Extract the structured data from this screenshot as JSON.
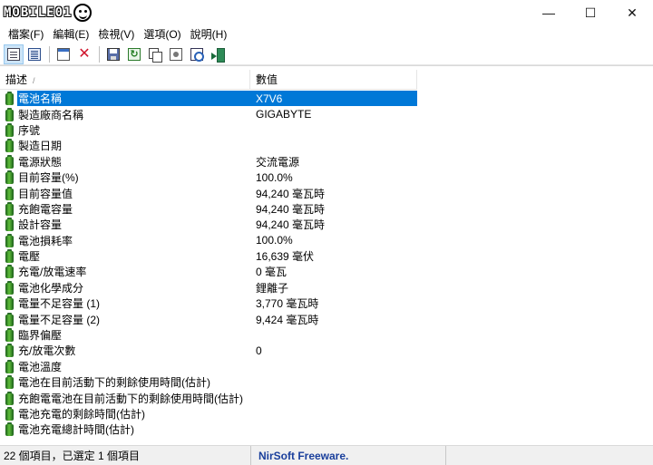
{
  "window": {
    "logo_text": "MOBILE01",
    "minimize": "—",
    "maximize": "☐",
    "close": "✕"
  },
  "menu": [
    {
      "label": "檔案(F)"
    },
    {
      "label": "編輯(E)"
    },
    {
      "label": "檢視(V)"
    },
    {
      "label": "選項(O)"
    },
    {
      "label": "說明(H)"
    }
  ],
  "toolbar": {
    "buttons": [
      {
        "icon": "html-report-icon",
        "active": true
      },
      {
        "icon": "list-view-icon",
        "active": false
      },
      {
        "icon": "window-icon"
      },
      {
        "icon": "delete-icon"
      },
      {
        "icon": "save-icon"
      },
      {
        "icon": "refresh-icon"
      },
      {
        "icon": "copy-icon"
      },
      {
        "icon": "properties-icon"
      },
      {
        "icon": "report-icon"
      },
      {
        "icon": "exit-icon"
      }
    ]
  },
  "columns": {
    "description": "描述",
    "sort_indicator": "/",
    "value": "數值"
  },
  "rows": [
    {
      "desc": "電池名稱",
      "value": "X7V6",
      "selected": true
    },
    {
      "desc": "製造廠商名稱",
      "value": "GIGABYTE"
    },
    {
      "desc": "序號",
      "value": ""
    },
    {
      "desc": "製造日期",
      "value": ""
    },
    {
      "desc": "電源狀態",
      "value": "交流電源"
    },
    {
      "desc": "目前容量(%)",
      "value": "100.0%"
    },
    {
      "desc": "目前容量值",
      "value": "94,240 毫瓦時"
    },
    {
      "desc": "充飽電容量",
      "value": "94,240 毫瓦時"
    },
    {
      "desc": "設計容量",
      "value": "94,240 毫瓦時"
    },
    {
      "desc": "電池損耗率",
      "value": "100.0%"
    },
    {
      "desc": "電壓",
      "value": "16,639 毫伏"
    },
    {
      "desc": "充電/放電速率",
      "value": "0 毫瓦"
    },
    {
      "desc": "電池化學成分",
      "value": "鋰離子"
    },
    {
      "desc": "電量不足容量 (1)",
      "value": "3,770 毫瓦時"
    },
    {
      "desc": "電量不足容量 (2)",
      "value": "9,424 毫瓦時"
    },
    {
      "desc": "臨界偏壓",
      "value": ""
    },
    {
      "desc": "充/放電次數",
      "value": "0"
    },
    {
      "desc": "電池溫度",
      "value": ""
    },
    {
      "desc": "電池在目前活動下的剩餘使用時間(估計)",
      "value": ""
    },
    {
      "desc": "充飽電電池在目前活動下的剩餘使用時間(估計)",
      "value": ""
    },
    {
      "desc": "電池充電的剩餘時間(估計)",
      "value": ""
    },
    {
      "desc": "電池充電總計時間(估計)",
      "value": ""
    }
  ],
  "status": {
    "count": "22 個項目，已選定 1 個項目",
    "link": "NirSoft Freeware.  http://www.nirsoft.net"
  },
  "colors": {
    "selection": "#0078d7",
    "link": "#1a3f9c",
    "battery": "#3a9a2a"
  }
}
